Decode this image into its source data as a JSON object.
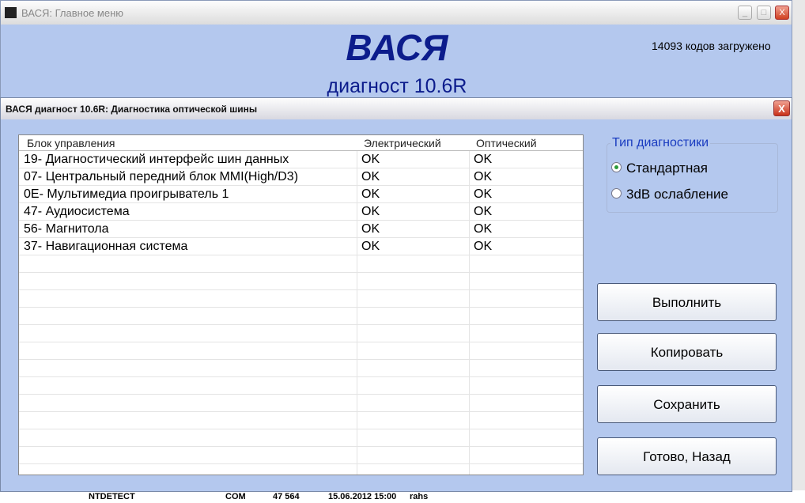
{
  "main_window": {
    "title": "ВАСЯ:  Главное меню",
    "logo": "ВАСЯ",
    "subtitle": "диагност 10.6R",
    "codes_loaded": "14093 кодов загружено"
  },
  "dialog": {
    "title": "ВАСЯ диагност 10.6R:  Диагностика оптической шины",
    "table": {
      "headers": [
        "Блок управления",
        "Электрический",
        "Оптический"
      ],
      "rows": [
        [
          "19- Диагностический интерфейс шин данных",
          "OK",
          "OK"
        ],
        [
          "07- Центральный передний блок MMI(High/D3)",
          "OK",
          "OK"
        ],
        [
          "0E- Мультимедиа проигрыватель 1",
          "OK",
          "OK"
        ],
        [
          "47- Аудиосистема",
          "OK",
          "OK"
        ],
        [
          "56- Магнитола",
          "OK",
          "OK"
        ],
        [
          "37- Навигационная система",
          "OK",
          "OK"
        ]
      ]
    },
    "diag_type": {
      "label": "Тип диагностики",
      "options": [
        "Стандартная",
        "3dB ослабление"
      ],
      "selected": "Стандартная"
    },
    "buttons": {
      "run": "Выполнить",
      "copy": "Копировать",
      "save": "Сохранить",
      "done": "Готово, Назад"
    }
  },
  "background": {
    "file_name": "NTDETECT",
    "file_ext": "COM",
    "file_size": "47 564",
    "file_date": "15.06.2012 15:00",
    "file_attr": "rahs"
  }
}
